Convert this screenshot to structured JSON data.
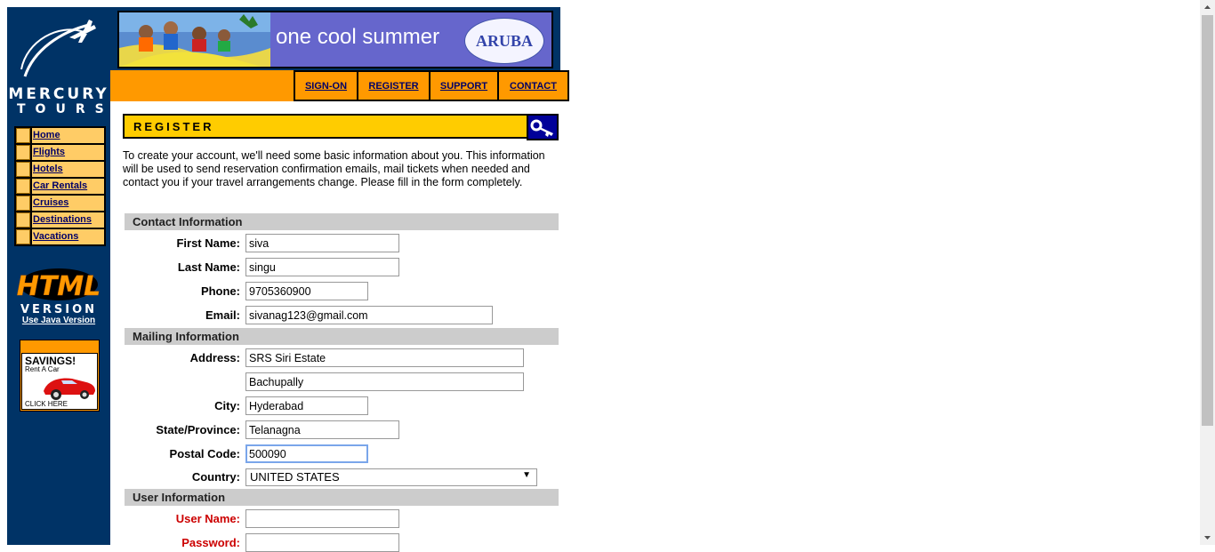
{
  "brand": {
    "line1": "MERCURY",
    "line2": "TOURS"
  },
  "nav": [
    {
      "label": "Home"
    },
    {
      "label": "Flights"
    },
    {
      "label": "Hotels"
    },
    {
      "label": "Car Rentals"
    },
    {
      "label": "Cruises"
    },
    {
      "label": "Destinations"
    },
    {
      "label": "Vacations"
    }
  ],
  "html_version": {
    "line1": "HTML",
    "line2": "VERSION",
    "java_link": "Use Java Version"
  },
  "ad": {
    "title": "SAVINGS!",
    "sub": "Rent A Car",
    "click": "CLICK HERE"
  },
  "banner": {
    "text": "one cool summer",
    "badge": "ARUBA"
  },
  "tabs": [
    {
      "label": "SIGN-ON"
    },
    {
      "label": "REGISTER"
    },
    {
      "label": "SUPPORT"
    },
    {
      "label": "CONTACT"
    }
  ],
  "page": {
    "title": "REGISTER",
    "intro": "To create your account, we'll need some basic information about you. This information will be used to send reservation confirmation emails, mail tickets when needed and contact you if your travel arrangements change. Please fill in the form completely."
  },
  "sections": {
    "contact": "Contact Information",
    "mailing": "Mailing Information",
    "user": "User Information"
  },
  "form": {
    "first_name": {
      "label": "First Name:",
      "value": "siva"
    },
    "last_name": {
      "label": "Last Name:",
      "value": "singu"
    },
    "phone": {
      "label": "Phone:",
      "value": "9705360900"
    },
    "email": {
      "label": "Email:",
      "value": "sivanag123@gmail.com"
    },
    "address": {
      "label": "Address:",
      "value1": "SRS Siri Estate",
      "value2": "Bachupally"
    },
    "city": {
      "label": "City:",
      "value": "Hyderabad"
    },
    "state": {
      "label": "State/Province:",
      "value": "Telanagna"
    },
    "postal": {
      "label": "Postal Code:",
      "value": "500090"
    },
    "country": {
      "label": "Country:",
      "value": "UNITED STATES"
    },
    "username": {
      "label": "User Name:",
      "value": ""
    },
    "password": {
      "label": "Password:",
      "value": ""
    }
  },
  "colors": {
    "sidebar": "#003366",
    "orange": "#ff9900",
    "header_yellow": "#ffcc00",
    "section_gray": "#cccccc",
    "required_red": "#cc0000"
  }
}
